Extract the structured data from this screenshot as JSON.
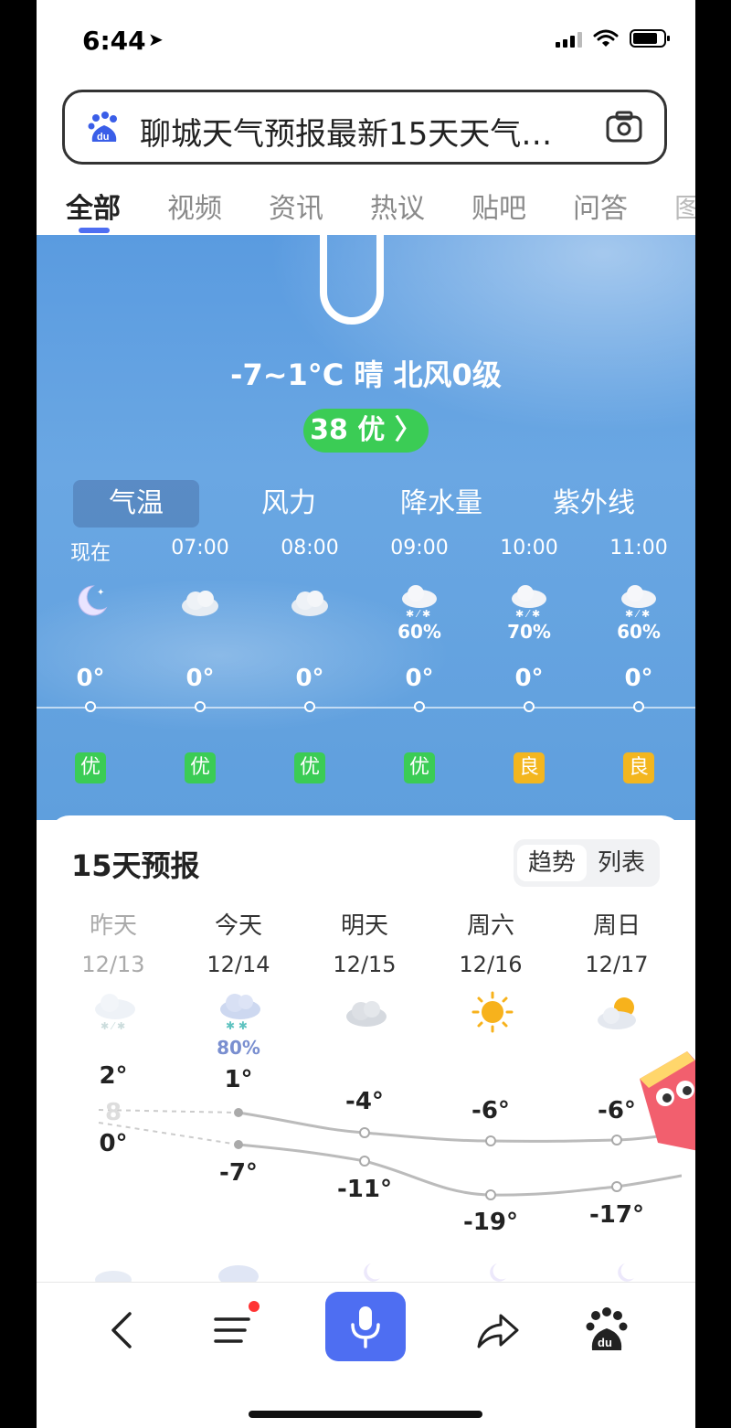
{
  "status_bar": {
    "time": "6:44",
    "location_arrow": "➤"
  },
  "search": {
    "query": "聊城天气预报最新15天天气…",
    "logo_icon": "baidu-paw-icon",
    "camera_icon": "camera-icon"
  },
  "tabs": [
    {
      "label": "全部",
      "active": true
    },
    {
      "label": "视频"
    },
    {
      "label": "资讯"
    },
    {
      "label": "热议"
    },
    {
      "label": "贴吧"
    },
    {
      "label": "问答"
    },
    {
      "label": "图"
    }
  ],
  "current": {
    "condition": "-7~1°C 晴 北风0级",
    "aqi": "38 优 〉"
  },
  "subtabs": [
    {
      "label": "气温",
      "active": true
    },
    {
      "label": "风力"
    },
    {
      "label": "降水量"
    },
    {
      "label": "紫外线"
    }
  ],
  "hourly": [
    {
      "time": "现在",
      "icon": "moon-night-icon",
      "pct": "",
      "temp": "0°",
      "aq": "优"
    },
    {
      "time": "07:00",
      "icon": "cloudy-icon",
      "pct": "",
      "temp": "0°",
      "aq": "优"
    },
    {
      "time": "08:00",
      "icon": "cloudy-icon",
      "pct": "",
      "temp": "0°",
      "aq": "优"
    },
    {
      "time": "09:00",
      "icon": "sleet-icon",
      "pct": "60%",
      "temp": "0°",
      "aq": "优"
    },
    {
      "time": "10:00",
      "icon": "sleet-icon",
      "pct": "70%",
      "temp": "0°",
      "aq": "良"
    },
    {
      "time": "11:00",
      "icon": "sleet-icon",
      "pct": "60%",
      "temp": "0°",
      "aq": "良"
    }
  ],
  "forecast": {
    "title": "15天预报",
    "toggle": [
      "趋势",
      "列表"
    ],
    "days": [
      {
        "name": "昨天",
        "date": "12/13",
        "icon": "sleet-icon",
        "pct": "",
        "hi": "2°",
        "lo": "0°",
        "past": true,
        "mid": "8"
      },
      {
        "name": "今天",
        "date": "12/14",
        "icon": "snow-icon",
        "pct": "80%",
        "hi": "1°",
        "lo": "-7°"
      },
      {
        "name": "明天",
        "date": "12/15",
        "icon": "cloudy-icon",
        "pct": "",
        "hi": "-4°",
        "lo": "-11°"
      },
      {
        "name": "周六",
        "date": "12/16",
        "icon": "sunny-icon",
        "pct": "",
        "hi": "-6°",
        "lo": "-19°"
      },
      {
        "name": "周日",
        "date": "12/17",
        "icon": "partly-cloudy-icon",
        "pct": "",
        "hi": "-6°",
        "lo": "-17°"
      }
    ]
  },
  "colors": {
    "accent": "#4e6ef2",
    "good": "#3bcc55",
    "moderate": "#f3b61f",
    "sky": "#62a1df"
  }
}
